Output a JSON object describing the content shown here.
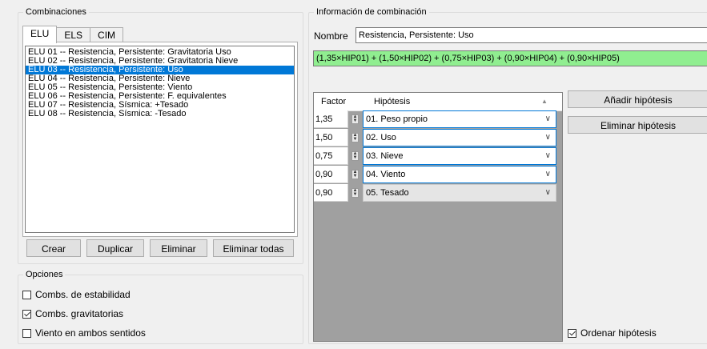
{
  "combinaciones": {
    "title": "Combinaciones",
    "tabs": [
      "ELU",
      "ELS",
      "CIM"
    ],
    "list": [
      "ELU 01 -- Resistencia, Persistente: Gravitatoria Uso",
      "ELU 02 -- Resistencia, Persistente: Gravitatoria Nieve",
      "ELU 03 -- Resistencia, Persistente: Uso",
      "ELU 04 -- Resistencia, Persistente: Nieve",
      "ELU 05 -- Resistencia, Persistente: Viento",
      "ELU 06 -- Resistencia, Persistente: F. equivalentes",
      "ELU 07 -- Resistencia, Sísmica: +Tesado",
      "ELU 08 -- Resistencia, Sísmica: -Tesado"
    ],
    "selected_index": 2,
    "buttons": {
      "crear": "Crear",
      "duplicar": "Duplicar",
      "eliminar": "Eliminar",
      "eliminar_todas": "Eliminar todas"
    }
  },
  "opciones": {
    "title": "Opciones",
    "items": [
      {
        "label": "Combs. de estabilidad",
        "checked": false
      },
      {
        "label": "Combs. gravitatorias",
        "checked": true
      },
      {
        "label": "Viento en ambos sentidos",
        "checked": false
      }
    ]
  },
  "info": {
    "title": "Información de combinación",
    "nombre_label": "Nombre",
    "nombre_value": "Resistencia, Persistente: Uso",
    "formula": "(1,35×HIP01) + (1,50×HIP02) + (0,75×HIP03) + (0,90×HIP04) + (0,90×HIP05)",
    "formula_color": "#90ee90",
    "grid": {
      "header_factor": "Factor",
      "header_hipotesis": "Hipótesis",
      "rows": [
        {
          "factor": "1,35",
          "hipotesis": "01. Peso propio",
          "editable": true
        },
        {
          "factor": "1,50",
          "hipotesis": "02. Uso",
          "editable": true
        },
        {
          "factor": "0,75",
          "hipotesis": "03. Nieve",
          "editable": true
        },
        {
          "factor": "0,90",
          "hipotesis": "04. Viento",
          "editable": true
        },
        {
          "factor": "0,90",
          "hipotesis": "05. Tesado",
          "editable": false
        }
      ]
    },
    "buttons": {
      "anadir": "Añadir hipótesis",
      "eliminar": "Eliminar hipótesis"
    },
    "ordenar": {
      "label": "Ordenar hipótesis",
      "checked": true
    }
  },
  "colors": {
    "selection": "#0078d7",
    "grid_bg": "#a0a0a0"
  }
}
